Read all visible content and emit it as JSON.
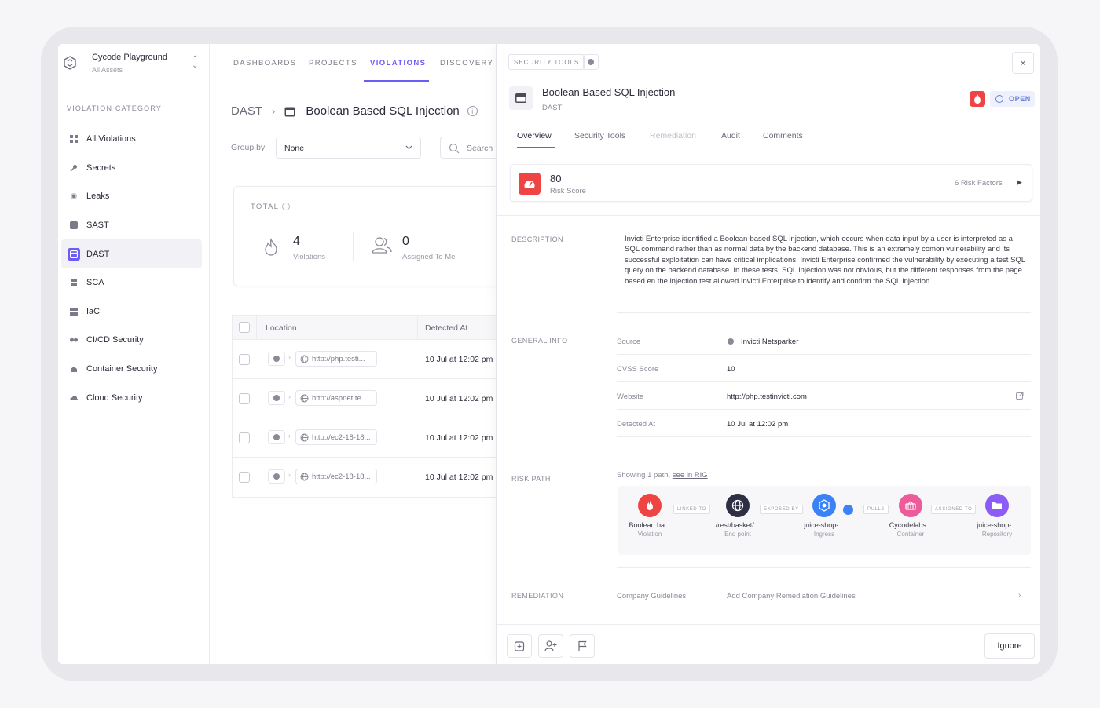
{
  "workspace": {
    "name": "Cycode Playground",
    "scope": "All Assets"
  },
  "sidebar": {
    "category_title": "VIOLATION CATEGORY",
    "items": [
      {
        "label": "All Violations",
        "icon": "grid-icon"
      },
      {
        "label": "Secrets",
        "icon": "key-icon"
      },
      {
        "label": "Leaks",
        "icon": "leak-icon"
      },
      {
        "label": "SAST",
        "icon": "code-icon"
      },
      {
        "label": "DAST",
        "icon": "browser-icon",
        "active": true
      },
      {
        "label": "SCA",
        "icon": "package-icon"
      },
      {
        "label": "IaC",
        "icon": "server-icon"
      },
      {
        "label": "CI/CD Security",
        "icon": "pipeline-icon"
      },
      {
        "label": "Container Security",
        "icon": "container-icon"
      },
      {
        "label": "Cloud Security",
        "icon": "cloud-icon"
      }
    ]
  },
  "topnav": {
    "tabs": [
      "DASHBOARDS",
      "PROJECTS",
      "VIOLATIONS",
      "DISCOVERY"
    ],
    "active": "VIOLATIONS"
  },
  "breadcrumb": {
    "parent": "DAST",
    "title": "Boolean Based SQL Injection"
  },
  "filters": {
    "group_by_label": "Group by",
    "group_by_value": "None",
    "search_placeholder": "Search"
  },
  "total": {
    "label": "TOTAL",
    "violations_count": "4",
    "violations_label": "Violations",
    "assigned_count": "0",
    "assigned_label": "Assigned To Me"
  },
  "table": {
    "columns": [
      "Location",
      "Detected At"
    ],
    "rows": [
      {
        "url": "http://php.testi...",
        "detected": "10 Jul at 12:02 pm"
      },
      {
        "url": "http://aspnet.te...",
        "detected": "10 Jul at 12:02 pm"
      },
      {
        "url": "http://ec2-18-18...",
        "detected": "10 Jul at 12:02 pm"
      },
      {
        "url": "http://ec2-18-18...",
        "detected": "10 Jul at 12:02 pm"
      }
    ]
  },
  "panel": {
    "tag": "SECURITY TOOLS",
    "title": "Boolean Based SQL Injection",
    "subtitle": "DAST",
    "status": "OPEN",
    "tabs": [
      "Overview",
      "Security Tools",
      "Remediation",
      "Audit",
      "Comments"
    ],
    "risk_score": "80",
    "risk_score_label": "Risk Score",
    "risk_factors": "6 Risk Factors",
    "description_label": "DESCRIPTION",
    "description": "Invicti Enterprise identified a Boolean-based SQL injection, which occurs when data input by a user is interpreted as a SQL command rather than as normal data by the backend database. This is an extremely comon vulnerability and its successful exploitation can have critical implications. Invicti Enterprise confirmed the vulnerability by executing a test SQL query on the backend database. In these tests, SQL injection was not obvious, but the different responses from the page based en the injection test allowed Invicti Enterprise to identify and confirm the SQL injection.",
    "general_info_label": "GENERAL INFO",
    "general_info": {
      "source_key": "Source",
      "source_val": "Invicti Netsparker",
      "cvss_key": "CVSS Score",
      "cvss_val": "10",
      "website_key": "Website",
      "website_val": "http://php.testinvicti.com",
      "detected_key": "Detected At",
      "detected_val": "10 Jul at 12:02 pm"
    },
    "risk_path_label": "RISK PATH",
    "risk_path_showing": "Showing 1 path,",
    "risk_path_link": "see in RIG",
    "risk_path": {
      "nodes": [
        {
          "name": "Boolean ba...",
          "type": "Violation",
          "color": "#ef4444"
        },
        {
          "name": "/rest/basket/...",
          "type": "End point",
          "color": "#2e2e44"
        },
        {
          "name": "juice-shop-...",
          "type": "Ingress",
          "color": "#3b82f6"
        },
        {
          "name": "Cycodelabs...",
          "type": "Container",
          "color": "#ec5c9a"
        },
        {
          "name": "juice-shop-...",
          "type": "Repository",
          "color": "#8b5cf6"
        }
      ],
      "edges": [
        "LINKED TO",
        "EXPOSED BY",
        "PULLS",
        "ASSIGNED TO"
      ]
    },
    "remediation_label": "REMEDIATION",
    "remediation_key": "Company Guidelines",
    "remediation_val": "Add Company Remediation Guidelines",
    "ignore_label": "Ignore"
  }
}
